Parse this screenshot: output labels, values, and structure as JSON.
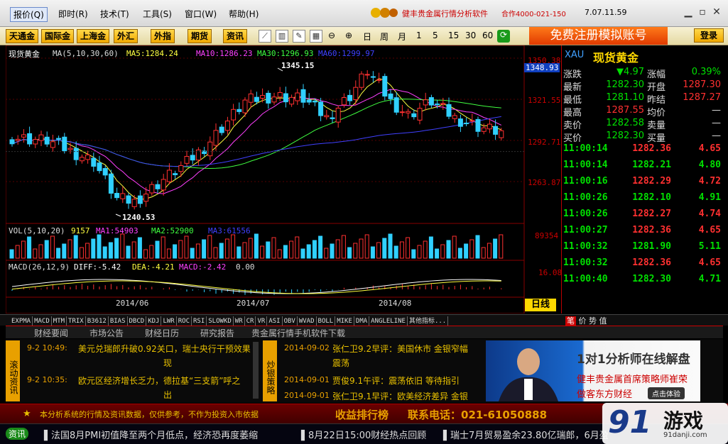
{
  "menu": [
    {
      "label": "报价(Q)"
    },
    {
      "label": "即时(R)"
    },
    {
      "label": "技术(T)"
    },
    {
      "label": "工具(S)"
    },
    {
      "label": "窗口(W)"
    },
    {
      "label": "帮助(H)"
    }
  ],
  "app_name": "健丰贵金属行情分析软件",
  "phone": "合作4000-021-150",
  "version": "7.07.11.59",
  "toolbar": {
    "markets": [
      "天通金",
      "国际金",
      "上海金",
      "外汇",
      "外指",
      "期货",
      "资讯"
    ],
    "periods": [
      "日",
      "周",
      "月",
      "1",
      "5",
      "15",
      "30",
      "60"
    ],
    "register": "免费注册模拟账号",
    "login": "登录"
  },
  "chart": {
    "instrument": "现货黄金",
    "ma_label": "MA(5,10,30,60)",
    "ma5": "MA5:1284.24",
    "ma10": "MA10:1286.23",
    "ma30": "MA30:1296.93",
    "ma60": "MA60:1299.97",
    "high_label": "1345.15",
    "low_label": "1240.53",
    "current_price": "1348.93",
    "price_ticks": [
      "1350.38",
      "1321.55",
      "1292.71",
      "1263.87"
    ],
    "vol_label": "VOL(5,10,20)",
    "vol_value": "9157",
    "vol_ma1": "MA1:54903",
    "vol_ma2": "MA2:52900",
    "vol_ma3": "MA3:61556",
    "vol_tick": "89354",
    "macd_label": "MACD(26,12,9)",
    "macd_diff": "DIFF:-5.42",
    "macd_dea": "DEA:-4.21",
    "macd_macd": "MACD:-2.42",
    "macd_zero": "0.00",
    "macd_tick": "16.08",
    "dates": [
      "2014/06",
      "2014/07",
      "2014/08"
    ],
    "period_badge": "日线"
  },
  "chart_data": {
    "type": "candlestick",
    "title": "现货黄金",
    "x": [
      "2014/06",
      "2014/07",
      "2014/08"
    ],
    "ylim": [
      1235,
      1352
    ],
    "annotations": [
      {
        "label": "1345.15",
        "value": 1345.15
      },
      {
        "label": "1240.53",
        "value": 1240.53
      }
    ],
    "y_ticks": [
      1350.38,
      1321.55,
      1292.71,
      1263.87
    ]
  },
  "side": {
    "symbol": "XAU",
    "name": "现货黄金",
    "rows": [
      {
        "l1": "涨跌",
        "v1": "▼4.97",
        "l2": "涨幅",
        "v2": "0.39%",
        "c1": "#00e000",
        "c2": "#00e000"
      },
      {
        "l1": "最新",
        "v1": "1282.30",
        "l2": "开盘",
        "v2": "1287.30",
        "c1": "#00e000",
        "c2": "#ff3030"
      },
      {
        "l1": "最低",
        "v1": "1281.10",
        "l2": "昨结",
        "v2": "1287.27",
        "c1": "#00e000",
        "c2": "#ff3030"
      },
      {
        "l1": "最高",
        "v1": "1287.55",
        "l2": "均价",
        "v2": "—",
        "c1": "#ff3030",
        "c2": "#ddd"
      },
      {
        "l1": "卖价",
        "v1": "1282.58",
        "l2": "卖量",
        "v2": "—",
        "c1": "#00e000",
        "c2": "#ddd"
      },
      {
        "l1": "买价",
        "v1": "1282.30",
        "l2": "买量",
        "v2": "—",
        "c1": "#00e000",
        "c2": "#ddd"
      }
    ],
    "ticks": [
      {
        "time": "11:00:14",
        "price": "1282.36",
        "vol": "4.65",
        "c": "#ff3030"
      },
      {
        "time": "11:00:14",
        "price": "1282.21",
        "vol": "4.80",
        "c": "#00e000"
      },
      {
        "time": "11:00:16",
        "price": "1282.29",
        "vol": "4.72",
        "c": "#ff3030"
      },
      {
        "time": "11:00:26",
        "price": "1282.10",
        "vol": "4.91",
        "c": "#00e000"
      },
      {
        "time": "11:00:26",
        "price": "1282.27",
        "vol": "4.74",
        "c": "#ff3030"
      },
      {
        "time": "11:00:27",
        "price": "1282.36",
        "vol": "4.65",
        "c": "#ff3030"
      },
      {
        "time": "11:00:32",
        "price": "1281.90",
        "vol": "5.11",
        "c": "#00e000"
      },
      {
        "time": "11:00:32",
        "price": "1282.36",
        "vol": "4.65",
        "c": "#ff3030"
      },
      {
        "time": "11:00:40",
        "price": "1282.30",
        "vol": "4.71",
        "c": "#00e000"
      }
    ],
    "bottom_tabs": [
      "笔",
      "价",
      "势",
      "值"
    ]
  },
  "indicators": [
    "EXPMA",
    "MACD",
    "MTM",
    "TRIX",
    "B3612",
    "BIAS",
    "DBCD",
    "KDJ",
    "LWR",
    "ROC",
    "RSI",
    "SLOWKD",
    "WR",
    "CR",
    "VR",
    "ASI",
    "OBV",
    "WVAD",
    "BOLL",
    "MIKE",
    "DMA",
    "ANGLELINE",
    "其他指标..."
  ],
  "news_tabs": [
    "财经要闻",
    "市场公告",
    "财经日历",
    "研究报告",
    "贵金属行情手机软件下载"
  ],
  "news_left_tag": "滚动资讯",
  "news_left": [
    {
      "time": "9-2 10:49:",
      "text": "美元兑瑞郎升破0.92关口，瑞士央行干预效果",
      "cont": "现"
    },
    {
      "time": "9-2 10:35:",
      "text": "欧元区经济增长乏力，德拉基“三支箭”呼之",
      "cont": "出"
    }
  ],
  "news_mid_tag": "炒银策略",
  "news_mid": [
    {
      "date": "2014-09-02",
      "text": "张仁卫9.2早评：美国休市 金银窄幅",
      "cont": "震荡"
    },
    {
      "date": "2014-09-01",
      "text": "贾俊9.1午评：震荡依旧 等待指引"
    },
    {
      "date": "2014-09-01",
      "text": "张仁卫9.1早评：欧美经济差异 金银"
    }
  ],
  "ad": {
    "title": "1对1分析师在线解盘",
    "line1": "健丰贵金属首席策略师崔荣",
    "line2": "做客东方财经",
    "button": "点击体验"
  },
  "bottom": {
    "notice": "本分析系统的行情及资讯数据，仅供参考，不作为投资入市依据",
    "rank": "收益排行榜",
    "tel": "联系电话：021-61050888"
  },
  "ticker": {
    "label": "资讯",
    "items": [
      "法国8月PMI初值降至两个月低点，经济恐再度萎缩",
      "8月22日15:00财经热点回顾",
      "瑞士7月贸易盈余23.80亿瑞郎，6月盈"
    ]
  },
  "watermark": {
    "text": "游戏",
    "sub": "91danji.com"
  }
}
